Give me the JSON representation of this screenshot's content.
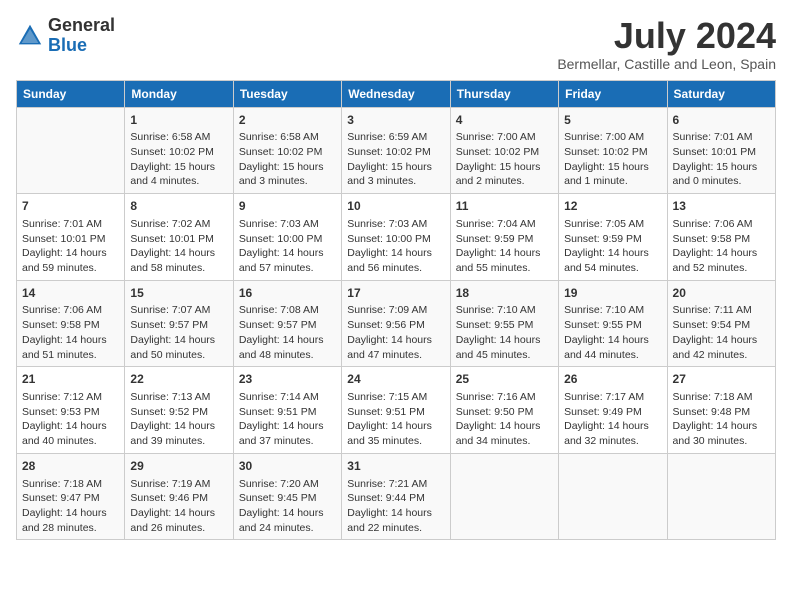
{
  "header": {
    "logo_general": "General",
    "logo_blue": "Blue",
    "month_year": "July 2024",
    "location": "Bermellar, Castille and Leon, Spain"
  },
  "weekdays": [
    "Sunday",
    "Monday",
    "Tuesday",
    "Wednesday",
    "Thursday",
    "Friday",
    "Saturday"
  ],
  "weeks": [
    [
      {
        "day": "",
        "info": ""
      },
      {
        "day": "1",
        "info": "Sunrise: 6:58 AM\nSunset: 10:02 PM\nDaylight: 15 hours\nand 4 minutes."
      },
      {
        "day": "2",
        "info": "Sunrise: 6:58 AM\nSunset: 10:02 PM\nDaylight: 15 hours\nand 3 minutes."
      },
      {
        "day": "3",
        "info": "Sunrise: 6:59 AM\nSunset: 10:02 PM\nDaylight: 15 hours\nand 3 minutes."
      },
      {
        "day": "4",
        "info": "Sunrise: 7:00 AM\nSunset: 10:02 PM\nDaylight: 15 hours\nand 2 minutes."
      },
      {
        "day": "5",
        "info": "Sunrise: 7:00 AM\nSunset: 10:02 PM\nDaylight: 15 hours\nand 1 minute."
      },
      {
        "day": "6",
        "info": "Sunrise: 7:01 AM\nSunset: 10:01 PM\nDaylight: 15 hours\nand 0 minutes."
      }
    ],
    [
      {
        "day": "7",
        "info": "Sunrise: 7:01 AM\nSunset: 10:01 PM\nDaylight: 14 hours\nand 59 minutes."
      },
      {
        "day": "8",
        "info": "Sunrise: 7:02 AM\nSunset: 10:01 PM\nDaylight: 14 hours\nand 58 minutes."
      },
      {
        "day": "9",
        "info": "Sunrise: 7:03 AM\nSunset: 10:00 PM\nDaylight: 14 hours\nand 57 minutes."
      },
      {
        "day": "10",
        "info": "Sunrise: 7:03 AM\nSunset: 10:00 PM\nDaylight: 14 hours\nand 56 minutes."
      },
      {
        "day": "11",
        "info": "Sunrise: 7:04 AM\nSunset: 9:59 PM\nDaylight: 14 hours\nand 55 minutes."
      },
      {
        "day": "12",
        "info": "Sunrise: 7:05 AM\nSunset: 9:59 PM\nDaylight: 14 hours\nand 54 minutes."
      },
      {
        "day": "13",
        "info": "Sunrise: 7:06 AM\nSunset: 9:58 PM\nDaylight: 14 hours\nand 52 minutes."
      }
    ],
    [
      {
        "day": "14",
        "info": "Sunrise: 7:06 AM\nSunset: 9:58 PM\nDaylight: 14 hours\nand 51 minutes."
      },
      {
        "day": "15",
        "info": "Sunrise: 7:07 AM\nSunset: 9:57 PM\nDaylight: 14 hours\nand 50 minutes."
      },
      {
        "day": "16",
        "info": "Sunrise: 7:08 AM\nSunset: 9:57 PM\nDaylight: 14 hours\nand 48 minutes."
      },
      {
        "day": "17",
        "info": "Sunrise: 7:09 AM\nSunset: 9:56 PM\nDaylight: 14 hours\nand 47 minutes."
      },
      {
        "day": "18",
        "info": "Sunrise: 7:10 AM\nSunset: 9:55 PM\nDaylight: 14 hours\nand 45 minutes."
      },
      {
        "day": "19",
        "info": "Sunrise: 7:10 AM\nSunset: 9:55 PM\nDaylight: 14 hours\nand 44 minutes."
      },
      {
        "day": "20",
        "info": "Sunrise: 7:11 AM\nSunset: 9:54 PM\nDaylight: 14 hours\nand 42 minutes."
      }
    ],
    [
      {
        "day": "21",
        "info": "Sunrise: 7:12 AM\nSunset: 9:53 PM\nDaylight: 14 hours\nand 40 minutes."
      },
      {
        "day": "22",
        "info": "Sunrise: 7:13 AM\nSunset: 9:52 PM\nDaylight: 14 hours\nand 39 minutes."
      },
      {
        "day": "23",
        "info": "Sunrise: 7:14 AM\nSunset: 9:51 PM\nDaylight: 14 hours\nand 37 minutes."
      },
      {
        "day": "24",
        "info": "Sunrise: 7:15 AM\nSunset: 9:51 PM\nDaylight: 14 hours\nand 35 minutes."
      },
      {
        "day": "25",
        "info": "Sunrise: 7:16 AM\nSunset: 9:50 PM\nDaylight: 14 hours\nand 34 minutes."
      },
      {
        "day": "26",
        "info": "Sunrise: 7:17 AM\nSunset: 9:49 PM\nDaylight: 14 hours\nand 32 minutes."
      },
      {
        "day": "27",
        "info": "Sunrise: 7:18 AM\nSunset: 9:48 PM\nDaylight: 14 hours\nand 30 minutes."
      }
    ],
    [
      {
        "day": "28",
        "info": "Sunrise: 7:18 AM\nSunset: 9:47 PM\nDaylight: 14 hours\nand 28 minutes."
      },
      {
        "day": "29",
        "info": "Sunrise: 7:19 AM\nSunset: 9:46 PM\nDaylight: 14 hours\nand 26 minutes."
      },
      {
        "day": "30",
        "info": "Sunrise: 7:20 AM\nSunset: 9:45 PM\nDaylight: 14 hours\nand 24 minutes."
      },
      {
        "day": "31",
        "info": "Sunrise: 7:21 AM\nSunset: 9:44 PM\nDaylight: 14 hours\nand 22 minutes."
      },
      {
        "day": "",
        "info": ""
      },
      {
        "day": "",
        "info": ""
      },
      {
        "day": "",
        "info": ""
      }
    ]
  ]
}
